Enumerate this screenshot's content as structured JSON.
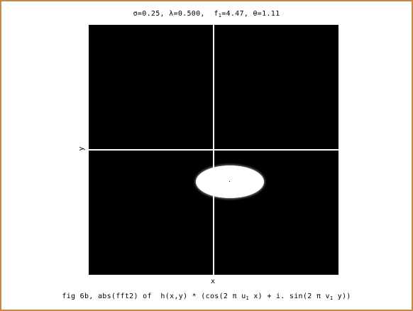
{
  "figure": {
    "title": {
      "part1": "σ=0.25, λ=0.500,  f",
      "sub1": "1",
      "part2": "=4.47, θ=1.11"
    },
    "axes": {
      "xlabel": "x",
      "ylabel": "y"
    },
    "caption": {
      "part1": "fig 6b, abs(fft2) of  h(x,y) * (cos(2 π u",
      "sub1": "1",
      "part2": " x) + i. sin(2 π v",
      "sub2": "1",
      "part3": " y))"
    },
    "colors": {
      "frame_border": "#c8884a",
      "plot_background": "#000000",
      "axis_lines": "#ffffff",
      "spot": "#ffffff"
    },
    "image_content": "black spectrum image with a white elliptical spot below and right of the centre crosshair"
  }
}
